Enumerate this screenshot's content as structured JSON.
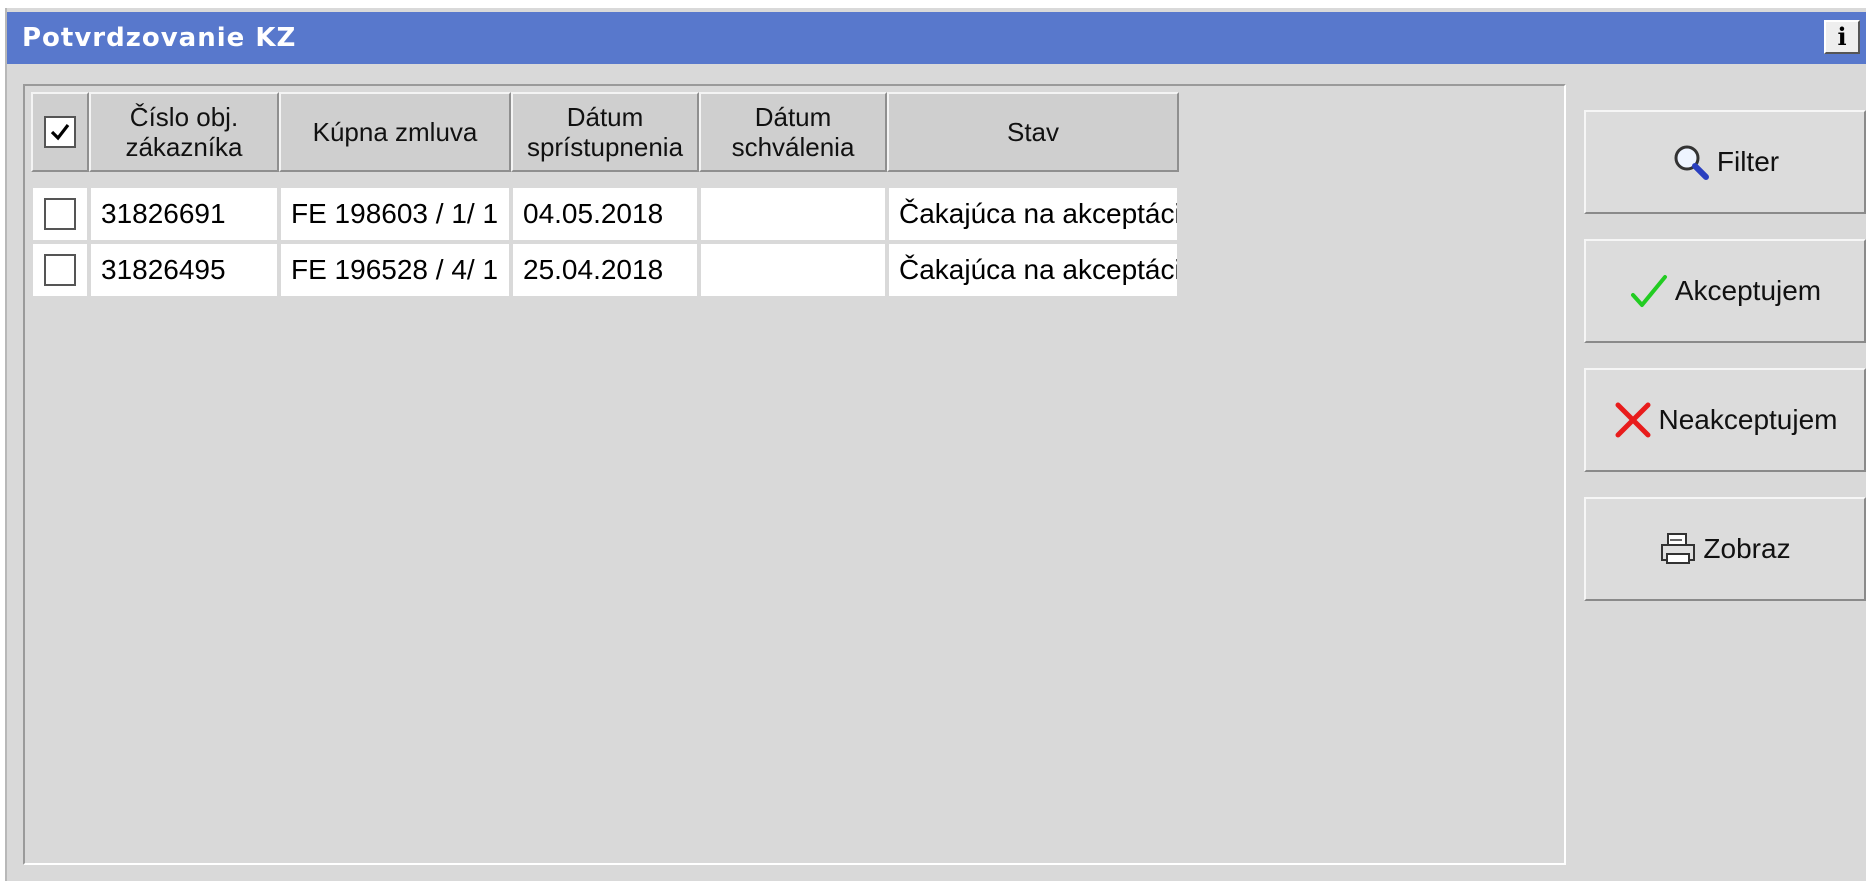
{
  "window": {
    "title": "Potvrdzovanie KZ",
    "info_label": "i"
  },
  "table": {
    "columns": [
      "Číslo obj.\nzákazníka",
      "Kúpna zmluva",
      "Dátum\nsprístupnenia",
      "Dátum\nschválenia",
      "Stav"
    ],
    "rows": [
      {
        "cislo": "31826691",
        "zmluva": "FE 198603 / 1/ 1",
        "spristupnenie": "04.05.2018",
        "schvalenie": "",
        "stav": "Čakajúca na akceptáciu"
      },
      {
        "cislo": "31826495",
        "zmluva": "FE 196528 / 4/ 1",
        "spristupnenie": "25.04.2018",
        "schvalenie": "",
        "stav": "Čakajúca na akceptáciu"
      }
    ]
  },
  "buttons": {
    "filter": "Filter",
    "accept": "Akceptujem",
    "reject": "Neakceptujem",
    "show": "Zobraz"
  },
  "icons": {
    "filter": "magnifier-icon",
    "accept": "checkmark-icon",
    "reject": "cross-icon",
    "show": "printer-icon"
  },
  "colors": {
    "titlebar": "#5878cc",
    "accept": "#22cc22",
    "reject": "#e81c1c"
  }
}
